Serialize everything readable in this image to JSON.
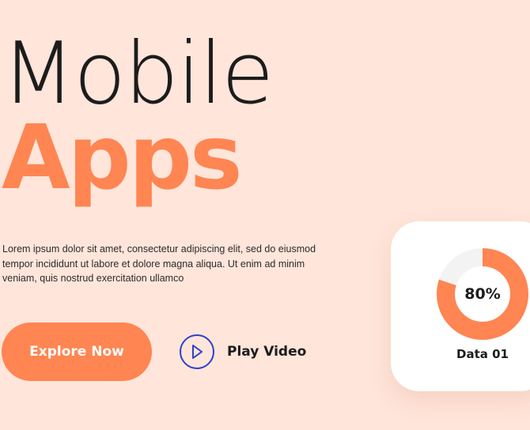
{
  "hero": {
    "title_line1": "Mobile",
    "title_line2": "Apps",
    "description": "Lorem ipsum dolor sit amet, consectetur adipiscing elit, sed do eiusmod tempor incididunt ut labore et dolore magna aliqua. Ut enim ad minim veniam, quis nostrud exercitation ullamco"
  },
  "actions": {
    "explore_label": "Explore Now",
    "play_label": "Play Video",
    "play_icon": "play-icon"
  },
  "stat_card": {
    "percent_value": 0.8,
    "percent_label": "80%",
    "label": "Data 01"
  },
  "colors": {
    "background": "#FFE5DA",
    "accent": "#FF8552",
    "play_icon": "#2D43C5",
    "track": "#F3F3F3"
  }
}
